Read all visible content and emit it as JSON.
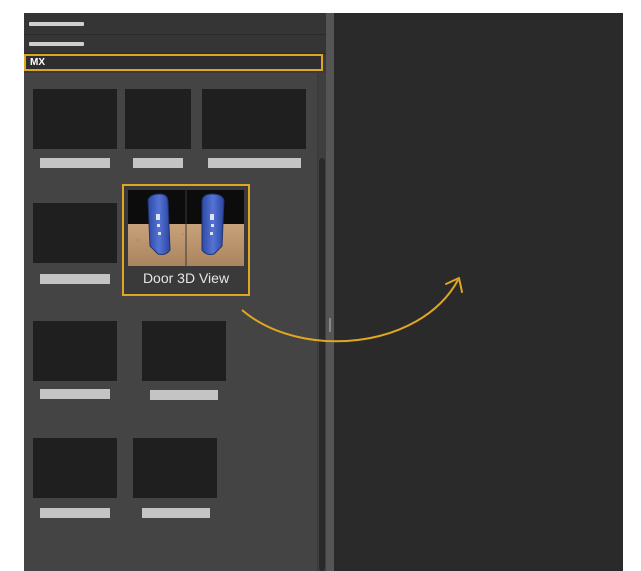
{
  "panel": {
    "section_label": "MX"
  },
  "selected_item": {
    "label": "Door 3D View",
    "icon": "door-3d-thumbnail"
  },
  "colors": {
    "highlight": "#e0a623",
    "panel_bg": "#444444",
    "viewport_bg": "#2a2a2a"
  }
}
